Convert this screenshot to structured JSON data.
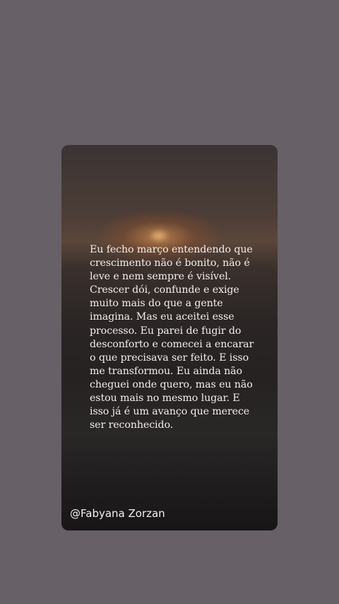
{
  "post": {
    "quote": "Eu fecho março entendendo que crescimento não é bonito, não é leve e nem sempre é visível. Crescer dói, confunde e exige muito mais do que a gente imagina. Mas eu aceitei esse processo. Eu parei de fugir do desconforto e comecei a encarar o que precisava ser feito. E isso me transformou. Eu ainda não cheguei onde quero, mas eu não estou mais no mesmo lugar. E isso já é um avanço que merece ser reconhecido.",
    "author_handle": "@Fabyana Zorzan"
  },
  "colors": {
    "background": "#676066",
    "card_dark": "#262222",
    "text": "#f2eeea"
  }
}
